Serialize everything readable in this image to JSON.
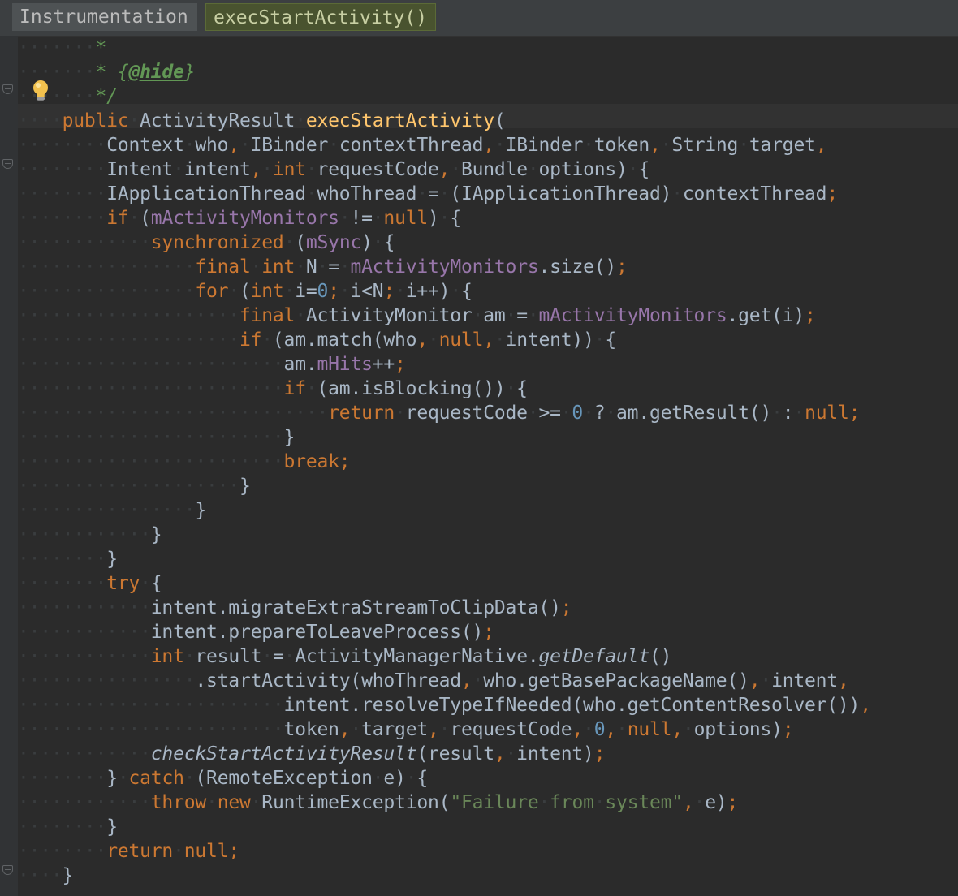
{
  "breadcrumbs": [
    "Instrumentation",
    "execStartActivity()"
  ],
  "code_lines": [
    [
      [
        "·······",
        "ws"
      ],
      [
        "*",
        "cm"
      ]
    ],
    [
      [
        "·······",
        "ws"
      ],
      [
        "* ",
        "cm"
      ],
      [
        "{",
        "cm"
      ],
      [
        "@hide",
        "tg"
      ],
      [
        "}",
        "cm"
      ]
    ],
    [
      [
        "·······",
        "ws"
      ],
      [
        "*/",
        "cm"
      ]
    ],
    [
      [
        "····",
        "ws"
      ],
      [
        "public",
        "kw"
      ],
      [
        "·",
        "ws"
      ],
      [
        "ActivityResult",
        "df"
      ],
      [
        "·",
        "ws"
      ],
      [
        "execStartActivity",
        "md"
      ],
      [
        "(",
        "df"
      ]
    ],
    [
      [
        "········",
        "ws"
      ],
      [
        "Context",
        "df"
      ],
      [
        "·",
        "ws"
      ],
      [
        "who",
        "df"
      ],
      [
        ",",
        "pn"
      ],
      [
        "·",
        "ws"
      ],
      [
        "IBinder",
        "df"
      ],
      [
        "·",
        "ws"
      ],
      [
        "contextThread",
        "df"
      ],
      [
        ",",
        "pn"
      ],
      [
        "·",
        "ws"
      ],
      [
        "IBinder",
        "df"
      ],
      [
        "·",
        "ws"
      ],
      [
        "token",
        "df"
      ],
      [
        ",",
        "pn"
      ],
      [
        "·",
        "ws"
      ],
      [
        "String",
        "df"
      ],
      [
        "·",
        "ws"
      ],
      [
        "target",
        "df"
      ],
      [
        ",",
        "pn"
      ]
    ],
    [
      [
        "········",
        "ws"
      ],
      [
        "Intent",
        "df"
      ],
      [
        "·",
        "ws"
      ],
      [
        "intent",
        "df"
      ],
      [
        ",",
        "pn"
      ],
      [
        "·",
        "ws"
      ],
      [
        "int",
        "kw"
      ],
      [
        "·",
        "ws"
      ],
      [
        "requestCode",
        "df"
      ],
      [
        ",",
        "pn"
      ],
      [
        "·",
        "ws"
      ],
      [
        "Bundle",
        "df"
      ],
      [
        "·",
        "ws"
      ],
      [
        "options",
        "df"
      ],
      [
        ")",
        "df"
      ],
      [
        "·",
        "ws"
      ],
      [
        "{",
        "df"
      ]
    ],
    [
      [
        "········",
        "ws"
      ],
      [
        "IApplicationThread",
        "df"
      ],
      [
        "·",
        "ws"
      ],
      [
        "whoThread",
        "df"
      ],
      [
        "·",
        "ws"
      ],
      [
        "=",
        "df"
      ],
      [
        "·",
        "ws"
      ],
      [
        "(IApplicationThread)",
        "df"
      ],
      [
        "·",
        "ws"
      ],
      [
        "contextThread",
        "df"
      ],
      [
        ";",
        "pn"
      ]
    ],
    [
      [
        "········",
        "ws"
      ],
      [
        "if",
        "kw"
      ],
      [
        "·",
        "ws"
      ],
      [
        "(",
        "df"
      ],
      [
        "mActivityMonitors",
        "fd"
      ],
      [
        "·",
        "ws"
      ],
      [
        "!=",
        "df"
      ],
      [
        "·",
        "ws"
      ],
      [
        "null",
        "kw"
      ],
      [
        ")",
        "df"
      ],
      [
        "·",
        "ws"
      ],
      [
        "{",
        "df"
      ]
    ],
    [
      [
        "············",
        "ws"
      ],
      [
        "synchronized",
        "kw"
      ],
      [
        "·",
        "ws"
      ],
      [
        "(",
        "df"
      ],
      [
        "mSync",
        "fd"
      ],
      [
        ")",
        "df"
      ],
      [
        "·",
        "ws"
      ],
      [
        "{",
        "df"
      ]
    ],
    [
      [
        "················",
        "ws"
      ],
      [
        "final",
        "kw"
      ],
      [
        "·",
        "ws"
      ],
      [
        "int",
        "kw"
      ],
      [
        "·",
        "ws"
      ],
      [
        "N",
        "df"
      ],
      [
        "·",
        "ws"
      ],
      [
        "=",
        "df"
      ],
      [
        "·",
        "ws"
      ],
      [
        "mActivityMonitors",
        "fd"
      ],
      [
        ".size()",
        "df"
      ],
      [
        ";",
        "pn"
      ]
    ],
    [
      [
        "················",
        "ws"
      ],
      [
        "for",
        "kw"
      ],
      [
        "·",
        "ws"
      ],
      [
        "(",
        "df"
      ],
      [
        "int",
        "kw"
      ],
      [
        "·",
        "ws"
      ],
      [
        "i=",
        "df"
      ],
      [
        "0",
        "nm"
      ],
      [
        ";",
        "pn"
      ],
      [
        "·",
        "ws"
      ],
      [
        "i<N",
        "df"
      ],
      [
        ";",
        "pn"
      ],
      [
        "·",
        "ws"
      ],
      [
        "i++)",
        "df"
      ],
      [
        "·",
        "ws"
      ],
      [
        "{",
        "df"
      ]
    ],
    [
      [
        "····················",
        "ws"
      ],
      [
        "final",
        "kw"
      ],
      [
        "·",
        "ws"
      ],
      [
        "ActivityMonitor",
        "df"
      ],
      [
        "·",
        "ws"
      ],
      [
        "am",
        "df"
      ],
      [
        "·",
        "ws"
      ],
      [
        "=",
        "df"
      ],
      [
        "·",
        "ws"
      ],
      [
        "mActivityMonitors",
        "fd"
      ],
      [
        ".get(i)",
        "df"
      ],
      [
        ";",
        "pn"
      ]
    ],
    [
      [
        "····················",
        "ws"
      ],
      [
        "if",
        "kw"
      ],
      [
        "·",
        "ws"
      ],
      [
        "(am.match(who",
        "df"
      ],
      [
        ",",
        "pn"
      ],
      [
        "·",
        "ws"
      ],
      [
        "null",
        "kw"
      ],
      [
        ",",
        "pn"
      ],
      [
        "·",
        "ws"
      ],
      [
        "intent))",
        "df"
      ],
      [
        "·",
        "ws"
      ],
      [
        "{",
        "df"
      ]
    ],
    [
      [
        "························",
        "ws"
      ],
      [
        "am.",
        "df"
      ],
      [
        "mHits",
        "fd"
      ],
      [
        "++",
        "df"
      ],
      [
        ";",
        "pn"
      ]
    ],
    [
      [
        "························",
        "ws"
      ],
      [
        "if",
        "kw"
      ],
      [
        "·",
        "ws"
      ],
      [
        "(am.isBlocking())",
        "df"
      ],
      [
        "·",
        "ws"
      ],
      [
        "{",
        "df"
      ]
    ],
    [
      [
        "····························",
        "ws"
      ],
      [
        "return",
        "kw"
      ],
      [
        "·",
        "ws"
      ],
      [
        "requestCode",
        "df"
      ],
      [
        "·",
        "ws"
      ],
      [
        ">=",
        "df"
      ],
      [
        "·",
        "ws"
      ],
      [
        "0",
        "nm"
      ],
      [
        "·",
        "ws"
      ],
      [
        "?",
        "df"
      ],
      [
        "·",
        "ws"
      ],
      [
        "am.getResult()",
        "df"
      ],
      [
        "·",
        "ws"
      ],
      [
        ":",
        "df"
      ],
      [
        "·",
        "ws"
      ],
      [
        "null",
        "kw"
      ],
      [
        ";",
        "pn"
      ]
    ],
    [
      [
        "························",
        "ws"
      ],
      [
        "}",
        "df"
      ]
    ],
    [
      [
        "························",
        "ws"
      ],
      [
        "break",
        "kw"
      ],
      [
        ";",
        "pn"
      ]
    ],
    [
      [
        "····················",
        "ws"
      ],
      [
        "}",
        "df"
      ]
    ],
    [
      [
        "················",
        "ws"
      ],
      [
        "}",
        "df"
      ]
    ],
    [
      [
        "············",
        "ws"
      ],
      [
        "}",
        "df"
      ]
    ],
    [
      [
        "········",
        "ws"
      ],
      [
        "}",
        "df"
      ]
    ],
    [
      [
        "········",
        "ws"
      ],
      [
        "try",
        "kw"
      ],
      [
        "·",
        "ws"
      ],
      [
        "{",
        "df"
      ]
    ],
    [
      [
        "············",
        "ws"
      ],
      [
        "intent.migrateExtraStreamToClipData()",
        "df"
      ],
      [
        ";",
        "pn"
      ]
    ],
    [
      [
        "············",
        "ws"
      ],
      [
        "intent.prepareToLeaveProcess()",
        "df"
      ],
      [
        ";",
        "pn"
      ]
    ],
    [
      [
        "············",
        "ws"
      ],
      [
        "int",
        "kw"
      ],
      [
        "·",
        "ws"
      ],
      [
        "result",
        "df"
      ],
      [
        "·",
        "ws"
      ],
      [
        "=",
        "df"
      ],
      [
        "·",
        "ws"
      ],
      [
        "ActivityManagerNative.",
        "df"
      ],
      [
        "getDefault",
        "it"
      ],
      [
        "()",
        "df"
      ]
    ],
    [
      [
        "················",
        "ws"
      ],
      [
        ".startActivity(whoThread",
        "df"
      ],
      [
        ",",
        "pn"
      ],
      [
        "·",
        "ws"
      ],
      [
        "who.getBasePackageName()",
        "df"
      ],
      [
        ",",
        "pn"
      ],
      [
        "·",
        "ws"
      ],
      [
        "intent",
        "df"
      ],
      [
        ",",
        "pn"
      ]
    ],
    [
      [
        "························",
        "ws"
      ],
      [
        "intent.resolveTypeIfNeeded(who.getContentResolver())",
        "df"
      ],
      [
        ",",
        "pn"
      ]
    ],
    [
      [
        "························",
        "ws"
      ],
      [
        "token",
        "df"
      ],
      [
        ",",
        "pn"
      ],
      [
        "·",
        "ws"
      ],
      [
        "target",
        "df"
      ],
      [
        ",",
        "pn"
      ],
      [
        "·",
        "ws"
      ],
      [
        "requestCode",
        "df"
      ],
      [
        ",",
        "pn"
      ],
      [
        "·",
        "ws"
      ],
      [
        "0",
        "nm"
      ],
      [
        ",",
        "pn"
      ],
      [
        "·",
        "ws"
      ],
      [
        "null",
        "kw"
      ],
      [
        ",",
        "pn"
      ],
      [
        "·",
        "ws"
      ],
      [
        "options)",
        "df"
      ],
      [
        ";",
        "pn"
      ]
    ],
    [
      [
        "············",
        "ws"
      ],
      [
        "checkStartActivityResult",
        "it"
      ],
      [
        "(result",
        "df"
      ],
      [
        ",",
        "pn"
      ],
      [
        "·",
        "ws"
      ],
      [
        "intent)",
        "df"
      ],
      [
        ";",
        "pn"
      ]
    ],
    [
      [
        "········",
        "ws"
      ],
      [
        "}",
        "df"
      ],
      [
        "·",
        "ws"
      ],
      [
        "catch",
        "kw"
      ],
      [
        "·",
        "ws"
      ],
      [
        "(RemoteException",
        "df"
      ],
      [
        "·",
        "ws"
      ],
      [
        "e)",
        "df"
      ],
      [
        "·",
        "ws"
      ],
      [
        "{",
        "df"
      ]
    ],
    [
      [
        "············",
        "ws"
      ],
      [
        "throw",
        "kw"
      ],
      [
        "·",
        "ws"
      ],
      [
        "new",
        "kw"
      ],
      [
        "·",
        "ws"
      ],
      [
        "RuntimeException(",
        "df"
      ],
      [
        "\"Failure",
        "st"
      ],
      [
        "·",
        "ws"
      ],
      [
        "from",
        "st"
      ],
      [
        "·",
        "ws"
      ],
      [
        "system\"",
        "st"
      ],
      [
        ",",
        "pn"
      ],
      [
        "·",
        "ws"
      ],
      [
        "e)",
        "df"
      ],
      [
        ";",
        "pn"
      ]
    ],
    [
      [
        "········",
        "ws"
      ],
      [
        "}",
        "df"
      ]
    ],
    [
      [
        "········",
        "ws"
      ],
      [
        "return",
        "kw"
      ],
      [
        "·",
        "ws"
      ],
      [
        "null",
        "kw"
      ],
      [
        ";",
        "pn"
      ]
    ],
    [
      [
        "····",
        "ws"
      ],
      [
        "}",
        "df"
      ]
    ]
  ],
  "colors": {
    "background": "#2b2b2b",
    "keyword": "#cc7832",
    "field": "#9876aa",
    "number": "#6897bb",
    "string": "#6a8759",
    "method_declaration": "#ffc66d",
    "doc_comment": "#629755",
    "default_text": "#a9b7c6"
  },
  "icons": [
    "fold-icon",
    "lightbulb-icon"
  ]
}
